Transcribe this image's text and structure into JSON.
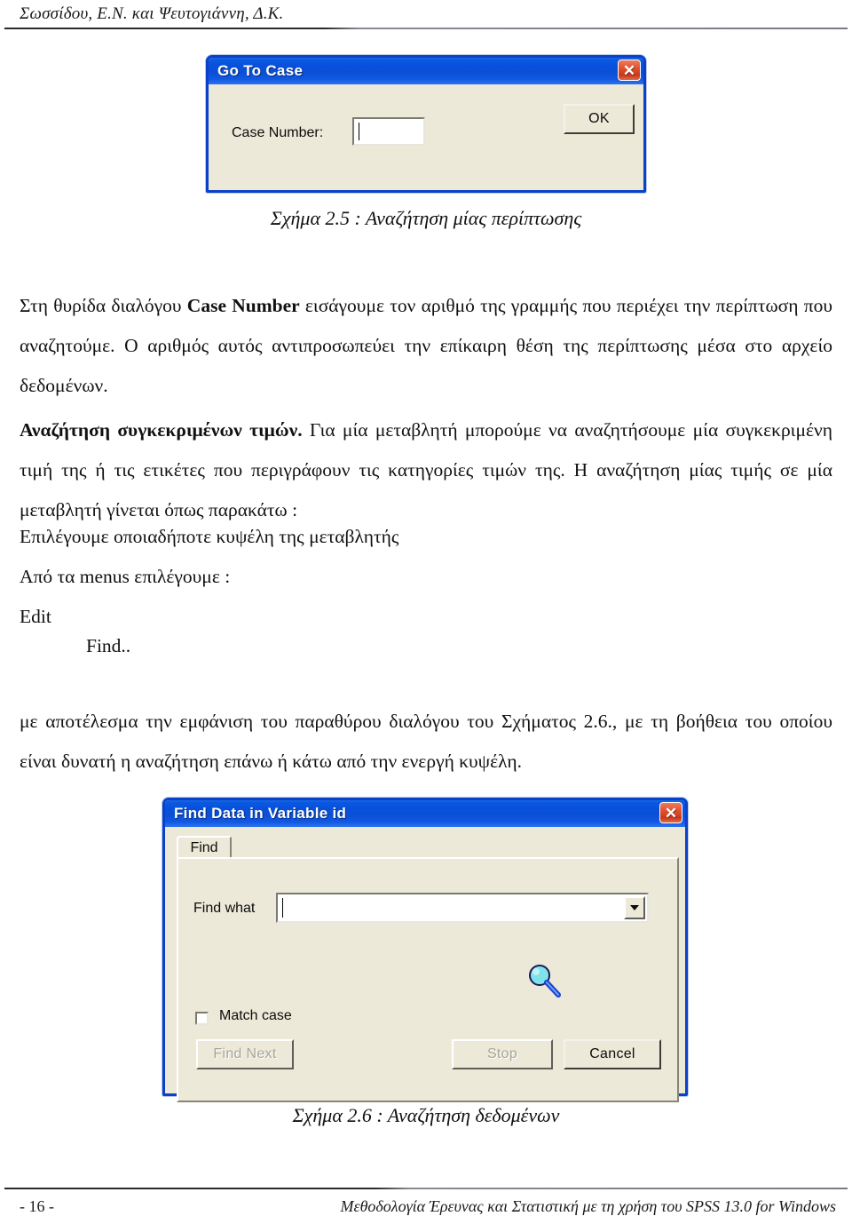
{
  "header": {
    "authors": "Σωσσίδου, Ε.Ν. και Ψευτογιάννη, Δ.Κ."
  },
  "dialog_go_to_case": {
    "title": "Go To Case",
    "close_glyph": "✕",
    "case_number_label": "Case Number:",
    "case_number_value": "",
    "ok_label": "OK"
  },
  "caption_25": "Σχήμα 2.5 : Αναζήτηση μίας περίπτωσης",
  "paragraphs": {
    "p1_pre": "Στη θυρίδα διαλόγου ",
    "p1_bold": "Case Number",
    "p1_post": " εισάγουμε τον αριθμό της γραμμής που περιέχει την περίπτωση που αναζητούμε. Ο αριθμός αυτός αντιπροσωπεύει την επίκαιρη θέση της περίπτωσης μέσα στο αρχείο δεδομένων.",
    "p2_bold": "Αναζήτηση συγκεκριμένων τιμών.",
    "p2_post": " Για μία μεταβλητή μπορούμε να αναζητήσουμε μία συγκεκριμένη τιμή της ή τις ετικέτες που περιγράφουν τις κατηγορίες τιμών της. Η αναζήτηση μίας τιμής σε μία μεταβλητή γίνεται όπως παρακάτω :",
    "step1": "Επιλέγουμε οποιαδήποτε κυψέλη της μεταβλητής",
    "step2": "Από τα menus επιλέγουμε :",
    "menu1": "Edit",
    "menu2": "Find..",
    "p3": "με αποτέλεσμα την εμφάνιση του παραθύρου διαλόγου του Σχήματος 2.6., με τη βοήθεια του οποίου είναι δυνατή η αναζήτηση επάνω ή κάτω από την ενεργή κυψέλη."
  },
  "dialog_find_data": {
    "title": "Find Data in Variable id",
    "close_glyph": "✕",
    "tab_find": "Find",
    "find_what_label": "Find what",
    "find_what_value": "",
    "match_case_label": "Match case",
    "match_case_checked": false,
    "find_next_label": "Find Next",
    "find_next_enabled": false,
    "stop_label": "Stop",
    "stop_enabled": false,
    "cancel_label": "Cancel",
    "cancel_enabled": true,
    "magnifier_icon": "magnifier-icon"
  },
  "caption_26": "Σχήμα 2.6 : Αναζήτηση δεδομένων",
  "footer": {
    "page_number": "- 16 -",
    "book_title": "Μεθοδολογία Έρευνας και Στατιστική με τη χρήση του SPSS 13.0 for Windows"
  },
  "colors": {
    "titlebar_blue": "#0a50dc",
    "dialog_face": "#ece9d8",
    "close_red": "#c8391b",
    "magnifier_glass": "#7fe3ea"
  }
}
